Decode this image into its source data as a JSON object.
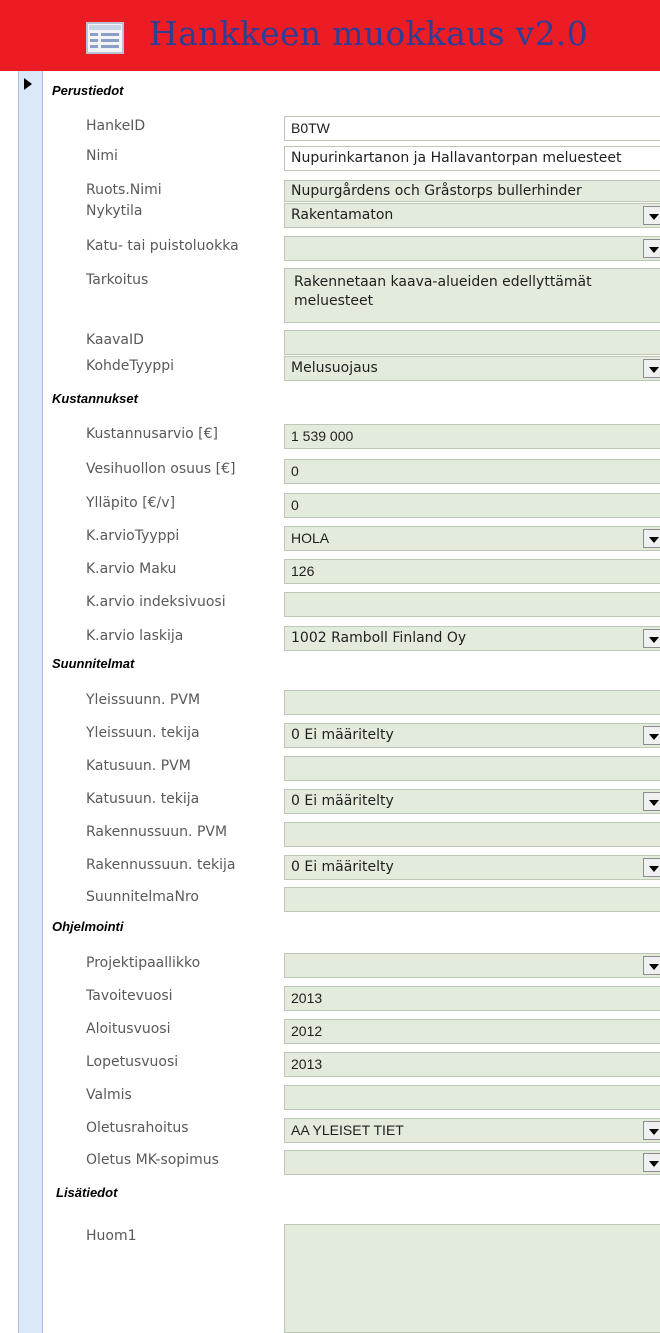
{
  "header": {
    "title": "Hankkeen muokkaus v2.0",
    "icon": "form-icon"
  },
  "sections": {
    "perus": "Perustiedot",
    "kust": "Kustannukset",
    "suun": "Suunnitelmat",
    "ohj": "Ohjelmointi",
    "lisa": "Lisätiedot"
  },
  "fields": {
    "hankeid": {
      "label": "HankeID",
      "value": "B0TW"
    },
    "nimi": {
      "label": "Nimi",
      "value": "Nupurinkartanon ja Hallavantorpan meluesteet"
    },
    "ruotsnimi": {
      "label": "Ruots.Nimi",
      "value": "Nupurgårdens och Gråstorps bullerhinder"
    },
    "nykytila": {
      "label": "Nykytila",
      "value": "Rakentamaton"
    },
    "katuluokka": {
      "label": "Katu- tai puistoluokka",
      "value": ""
    },
    "tarkoitus": {
      "label": "Tarkoitus",
      "value": "Rakennetaan kaava-alueiden edellyttämät meluesteet"
    },
    "kaavaid": {
      "label": "KaavaID",
      "value": ""
    },
    "kohdetyyppi": {
      "label": "KohdeTyyppi",
      "value": "Melusuojaus"
    },
    "kustannusarvio": {
      "label": "Kustannusarvio [€]",
      "value": "1 539 000"
    },
    "vesihuolto": {
      "label": "Vesihuollon osuus [€]",
      "value": "0"
    },
    "yllapito": {
      "label": "Ylläpito [€/v]",
      "value": "0"
    },
    "karviotyyppi": {
      "label": "K.arvioTyyppi",
      "value": "HOLA"
    },
    "karviomaku": {
      "label": "K.arvio Maku",
      "value": "126"
    },
    "karvioindeksi": {
      "label": "K.arvio indeksivuosi",
      "value": ""
    },
    "karviolaskija": {
      "label": "K.arvio laskija",
      "value": "1002 Ramboll Finland Oy"
    },
    "yleispvm": {
      "label": "Yleissuunn. PVM",
      "value": ""
    },
    "yleistekija": {
      "label": "Yleissuun. tekija",
      "value": "0 Ei määritelty"
    },
    "katupvm": {
      "label": "Katusuun. PVM",
      "value": ""
    },
    "katutekija": {
      "label": "Katusuun. tekija",
      "value": "0 Ei määritelty"
    },
    "rakpvm": {
      "label": "Rakennussuun. PVM",
      "value": ""
    },
    "raktekija": {
      "label": "Rakennussuun. tekija",
      "value": "0 Ei määritelty"
    },
    "suunnitelmanro": {
      "label": "SuunnitelmaNro",
      "value": ""
    },
    "projektipaallikko": {
      "label": "Projektipaallikko",
      "value": ""
    },
    "tavoitevuosi": {
      "label": "Tavoitevuosi",
      "value": "2013"
    },
    "aloitusvuosi": {
      "label": "Aloitusvuosi",
      "value": "2012"
    },
    "lopetusvuosi": {
      "label": "Lopetusvuosi",
      "value": "2013"
    },
    "valmis": {
      "label": "Valmis",
      "value": ""
    },
    "oletusrahoitus": {
      "label": "Oletusrahoitus",
      "value": "AA YLEISET TIET"
    },
    "oletusmk": {
      "label": "Oletus MK-sopimus",
      "value": ""
    },
    "huom1": {
      "label": "Huom1",
      "value": ""
    }
  }
}
